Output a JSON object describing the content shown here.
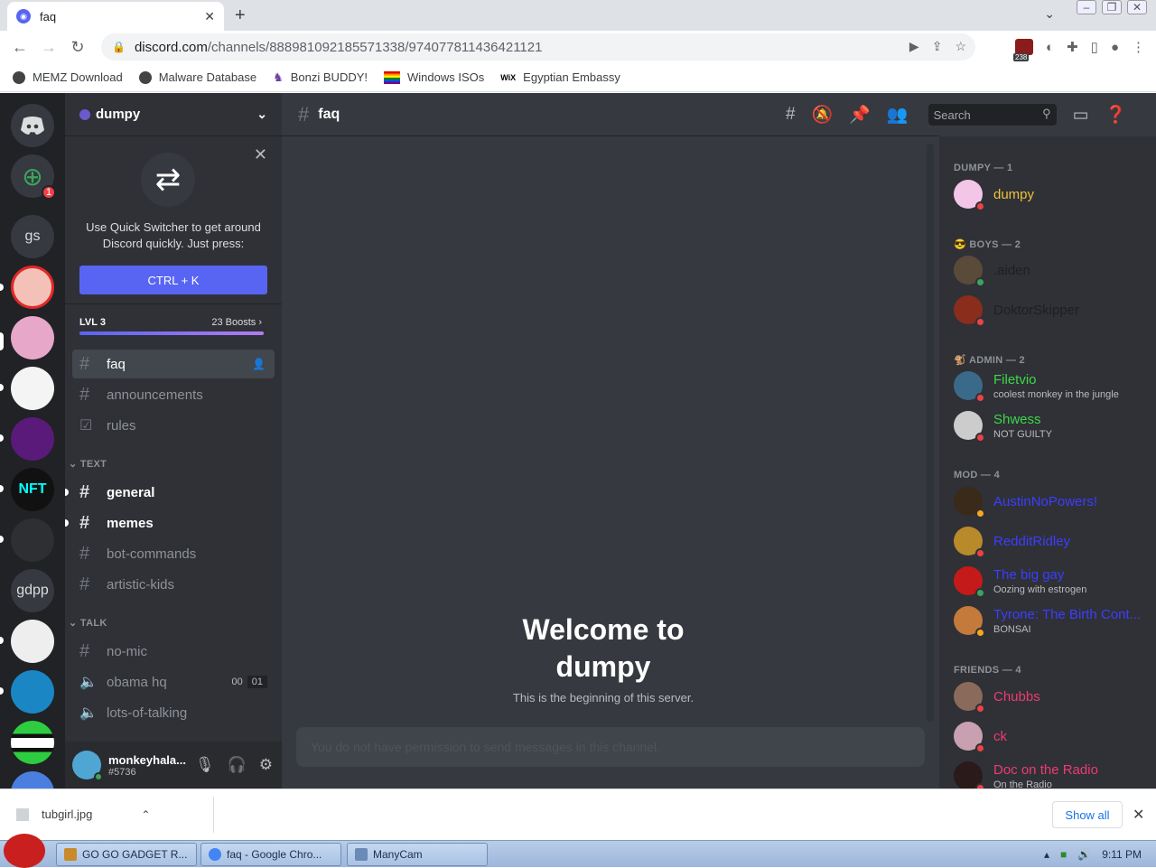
{
  "browser": {
    "tab_title": "faq",
    "url_host": "discord.com",
    "url_path": "/channels/888981092185571338/974077811436421121",
    "extension_badge": "238",
    "bookmarks": [
      "MEMZ Download",
      "Malware Database",
      "Bonzi BUDDY!",
      "Windows ISOs",
      "Egyptian Embassy"
    ]
  },
  "guilds": [
    "gs",
    "gdpp"
  ],
  "add_server_badge": "1",
  "server": {
    "name": "dumpy",
    "quick_switcher_text": "Use Quick Switcher to get around Discord quickly. Just press:",
    "quick_switcher_key": "CTRL + K",
    "level": "LVL 3",
    "boosts": "23 Boosts"
  },
  "channels_top": [
    {
      "name": "faq",
      "active": true
    },
    {
      "name": "announcements"
    },
    {
      "name": "rules"
    }
  ],
  "categories": {
    "text": "TEXT",
    "talk": "TALK"
  },
  "text_channels": [
    "general",
    "memes",
    "bot-commands",
    "artistic-kids"
  ],
  "talk_channels": [
    "no-mic",
    "obama hq",
    "lots-of-talking"
  ],
  "voice_count": [
    "00",
    "01"
  ],
  "user": {
    "name": "monkeyhala...",
    "tag": "#5736"
  },
  "main": {
    "channel": "faq",
    "search_placeholder": "Search",
    "welcome_line1": "Welcome to",
    "welcome_line2": "dumpy",
    "beginning": "This is the beginning of this server.",
    "message_placeholder": "You do not have permission to send messages in this channel."
  },
  "member_groups": [
    {
      "title": "DUMPY — 1",
      "members": [
        {
          "name": "dumpy",
          "color": "#f0c23b"
        }
      ]
    },
    {
      "title": "BOYS — 2",
      "members": [
        {
          "name": ".aiden",
          "color": "#1e1f22"
        },
        {
          "name": "DoktorSkipper",
          "color": "#1e1f22"
        }
      ]
    },
    {
      "title": "ADMIN — 2",
      "members": [
        {
          "name": "Filetvio",
          "color": "#3bd64a",
          "status": "coolest monkey in the jungle"
        },
        {
          "name": "Shwess",
          "color": "#3bd64a",
          "status": "NOT GUILTY"
        }
      ]
    },
    {
      "title": "MOD — 4",
      "members": [
        {
          "name": "AustinNoPowers!",
          "color": "#3d3dff"
        },
        {
          "name": "RedditRidley",
          "color": "#3d3dff"
        },
        {
          "name": "The big gay",
          "color": "#3d3dff",
          "status": "Oozing with estrogen"
        },
        {
          "name": "Tyrone: The Birth Cont...",
          "color": "#3d3dff",
          "status": "BONSAI"
        }
      ]
    },
    {
      "title": "FRIENDS — 4",
      "members": [
        {
          "name": "Chubbs",
          "color": "#ee3a72"
        },
        {
          "name": "ck",
          "color": "#ee3a72"
        },
        {
          "name": "Doc on the Radio",
          "color": "#ee3a72",
          "status": "On the Radio"
        }
      ]
    }
  ],
  "download": {
    "file": "tubgirl.jpg",
    "show_all": "Show all"
  },
  "taskbar": {
    "items": [
      "GO GO GADGET R...",
      "faq - Google Chro...",
      "ManyCam"
    ],
    "time": "9:11 PM"
  }
}
